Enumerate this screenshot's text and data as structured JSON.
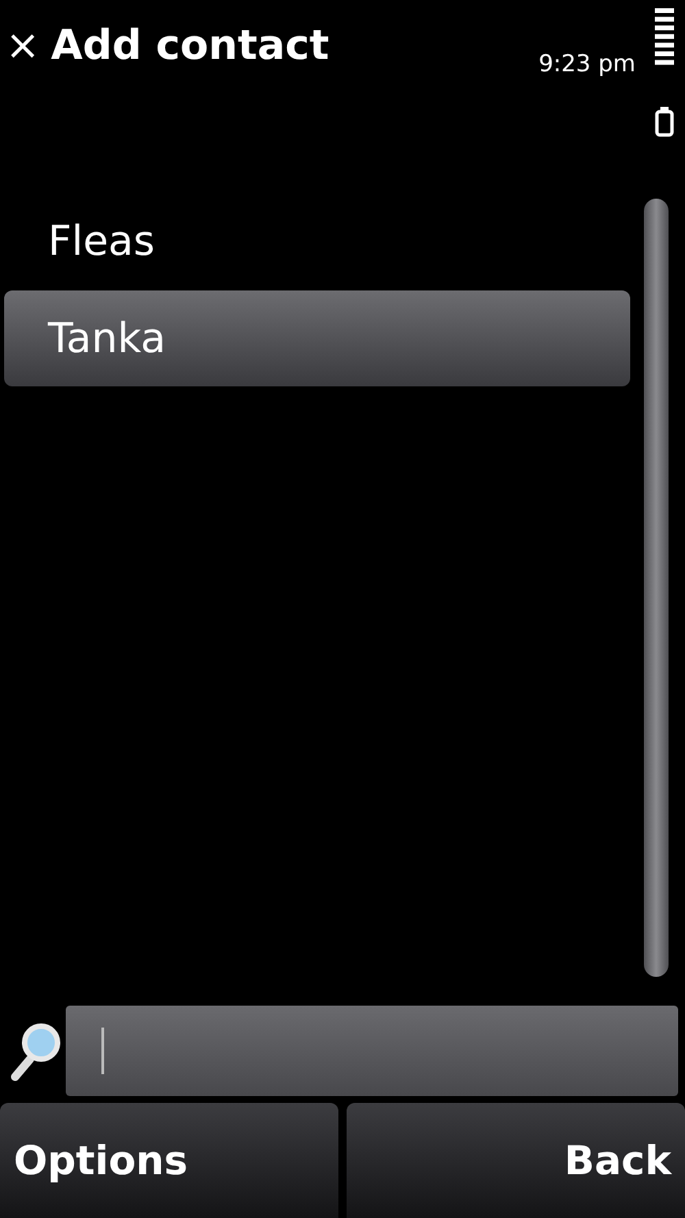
{
  "header": {
    "close": "×",
    "title": "Add contact",
    "time": "9:23 pm"
  },
  "contacts": [
    {
      "name": "Fleas",
      "selected": false
    },
    {
      "name": "Tanka",
      "selected": true
    }
  ],
  "softkeys": [
    "Options",
    "Back"
  ]
}
